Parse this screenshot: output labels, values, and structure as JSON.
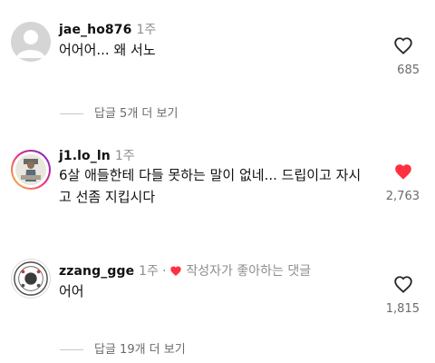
{
  "comments": [
    {
      "username": "jae_ho876",
      "time": "1주",
      "text": "어어어... 왜 서노",
      "likes": "685",
      "liked": false,
      "avatar": "default-avatar"
    },
    {
      "username": "j1.lo_ln",
      "time": "1주",
      "text": "6살 애들한테 다들 못하는 말이 없네... 드립이고 자시고 선좀 지킵시다",
      "likes": "2,763",
      "liked": true,
      "avatar": "story-avatar"
    },
    {
      "username": "zzang_gge",
      "time": "1주",
      "creator_like_dot": "·",
      "creator_like": "작성자가 좋아하는 댓글",
      "text": "어어",
      "likes": "1,815",
      "liked": false,
      "avatar": "profile-avatar"
    }
  ],
  "view_replies": [
    "답글 5개 더 보기",
    "답글 19개 더 보기"
  ],
  "colors": {
    "heart_liked": "#ff3040",
    "secondary_text": "#8e8e8e"
  }
}
